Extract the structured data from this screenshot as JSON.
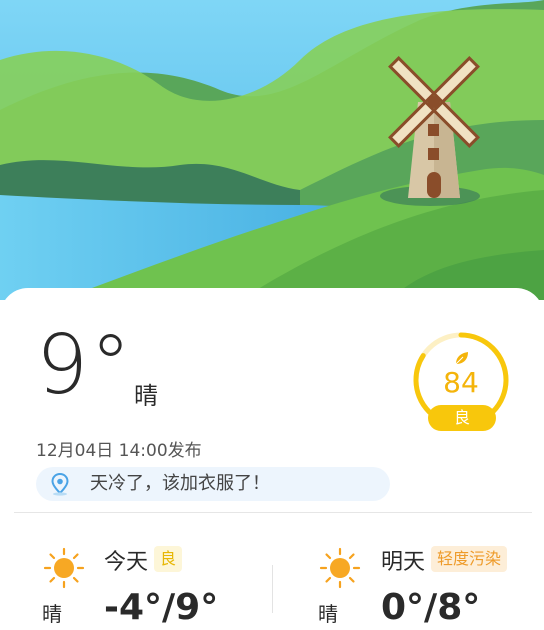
{
  "current": {
    "temperature": "9°",
    "condition": "晴",
    "published": "12月04日 14:00发布",
    "tip": "天冷了，该加衣服了！"
  },
  "aqi": {
    "value": "84",
    "level": "良",
    "ring_fraction": 0.84
  },
  "forecast": [
    {
      "day": "今天",
      "aqi_level": "良",
      "condition": "晴",
      "range": "-4°/9°",
      "icon": "sun-icon"
    },
    {
      "day": "明天",
      "aqi_level": "轻度污染",
      "condition": "晴",
      "range": "0°/8°",
      "icon": "sun-icon"
    }
  ],
  "colors": {
    "sky": "#6cc8f0",
    "hill_light": "#7ccc4f",
    "hill_dark": "#3f8a55",
    "water": "#5dbfea",
    "aqi": "#f8c70c",
    "tip_bg": "#edf5fd"
  }
}
